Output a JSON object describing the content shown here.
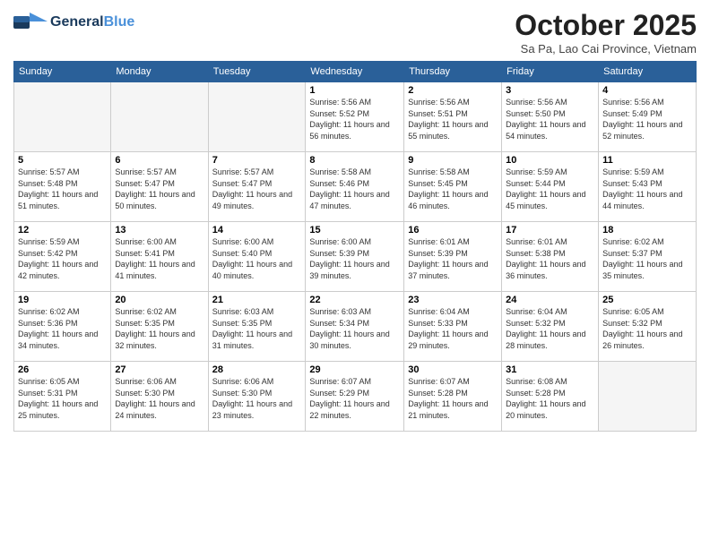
{
  "header": {
    "logo_general": "General",
    "logo_blue": "Blue",
    "month": "October 2025",
    "location": "Sa Pa, Lao Cai Province, Vietnam"
  },
  "days_of_week": [
    "Sunday",
    "Monday",
    "Tuesday",
    "Wednesday",
    "Thursday",
    "Friday",
    "Saturday"
  ],
  "weeks": [
    [
      {
        "day": "",
        "info": ""
      },
      {
        "day": "",
        "info": ""
      },
      {
        "day": "",
        "info": ""
      },
      {
        "day": "1",
        "info": "Sunrise: 5:56 AM\nSunset: 5:52 PM\nDaylight: 11 hours and 56 minutes."
      },
      {
        "day": "2",
        "info": "Sunrise: 5:56 AM\nSunset: 5:51 PM\nDaylight: 11 hours and 55 minutes."
      },
      {
        "day": "3",
        "info": "Sunrise: 5:56 AM\nSunset: 5:50 PM\nDaylight: 11 hours and 54 minutes."
      },
      {
        "day": "4",
        "info": "Sunrise: 5:56 AM\nSunset: 5:49 PM\nDaylight: 11 hours and 52 minutes."
      }
    ],
    [
      {
        "day": "5",
        "info": "Sunrise: 5:57 AM\nSunset: 5:48 PM\nDaylight: 11 hours and 51 minutes."
      },
      {
        "day": "6",
        "info": "Sunrise: 5:57 AM\nSunset: 5:47 PM\nDaylight: 11 hours and 50 minutes."
      },
      {
        "day": "7",
        "info": "Sunrise: 5:57 AM\nSunset: 5:47 PM\nDaylight: 11 hours and 49 minutes."
      },
      {
        "day": "8",
        "info": "Sunrise: 5:58 AM\nSunset: 5:46 PM\nDaylight: 11 hours and 47 minutes."
      },
      {
        "day": "9",
        "info": "Sunrise: 5:58 AM\nSunset: 5:45 PM\nDaylight: 11 hours and 46 minutes."
      },
      {
        "day": "10",
        "info": "Sunrise: 5:59 AM\nSunset: 5:44 PM\nDaylight: 11 hours and 45 minutes."
      },
      {
        "day": "11",
        "info": "Sunrise: 5:59 AM\nSunset: 5:43 PM\nDaylight: 11 hours and 44 minutes."
      }
    ],
    [
      {
        "day": "12",
        "info": "Sunrise: 5:59 AM\nSunset: 5:42 PM\nDaylight: 11 hours and 42 minutes."
      },
      {
        "day": "13",
        "info": "Sunrise: 6:00 AM\nSunset: 5:41 PM\nDaylight: 11 hours and 41 minutes."
      },
      {
        "day": "14",
        "info": "Sunrise: 6:00 AM\nSunset: 5:40 PM\nDaylight: 11 hours and 40 minutes."
      },
      {
        "day": "15",
        "info": "Sunrise: 6:00 AM\nSunset: 5:39 PM\nDaylight: 11 hours and 39 minutes."
      },
      {
        "day": "16",
        "info": "Sunrise: 6:01 AM\nSunset: 5:39 PM\nDaylight: 11 hours and 37 minutes."
      },
      {
        "day": "17",
        "info": "Sunrise: 6:01 AM\nSunset: 5:38 PM\nDaylight: 11 hours and 36 minutes."
      },
      {
        "day": "18",
        "info": "Sunrise: 6:02 AM\nSunset: 5:37 PM\nDaylight: 11 hours and 35 minutes."
      }
    ],
    [
      {
        "day": "19",
        "info": "Sunrise: 6:02 AM\nSunset: 5:36 PM\nDaylight: 11 hours and 34 minutes."
      },
      {
        "day": "20",
        "info": "Sunrise: 6:02 AM\nSunset: 5:35 PM\nDaylight: 11 hours and 32 minutes."
      },
      {
        "day": "21",
        "info": "Sunrise: 6:03 AM\nSunset: 5:35 PM\nDaylight: 11 hours and 31 minutes."
      },
      {
        "day": "22",
        "info": "Sunrise: 6:03 AM\nSunset: 5:34 PM\nDaylight: 11 hours and 30 minutes."
      },
      {
        "day": "23",
        "info": "Sunrise: 6:04 AM\nSunset: 5:33 PM\nDaylight: 11 hours and 29 minutes."
      },
      {
        "day": "24",
        "info": "Sunrise: 6:04 AM\nSunset: 5:32 PM\nDaylight: 11 hours and 28 minutes."
      },
      {
        "day": "25",
        "info": "Sunrise: 6:05 AM\nSunset: 5:32 PM\nDaylight: 11 hours and 26 minutes."
      }
    ],
    [
      {
        "day": "26",
        "info": "Sunrise: 6:05 AM\nSunset: 5:31 PM\nDaylight: 11 hours and 25 minutes."
      },
      {
        "day": "27",
        "info": "Sunrise: 6:06 AM\nSunset: 5:30 PM\nDaylight: 11 hours and 24 minutes."
      },
      {
        "day": "28",
        "info": "Sunrise: 6:06 AM\nSunset: 5:30 PM\nDaylight: 11 hours and 23 minutes."
      },
      {
        "day": "29",
        "info": "Sunrise: 6:07 AM\nSunset: 5:29 PM\nDaylight: 11 hours and 22 minutes."
      },
      {
        "day": "30",
        "info": "Sunrise: 6:07 AM\nSunset: 5:28 PM\nDaylight: 11 hours and 21 minutes."
      },
      {
        "day": "31",
        "info": "Sunrise: 6:08 AM\nSunset: 5:28 PM\nDaylight: 11 hours and 20 minutes."
      },
      {
        "day": "",
        "info": ""
      }
    ]
  ]
}
